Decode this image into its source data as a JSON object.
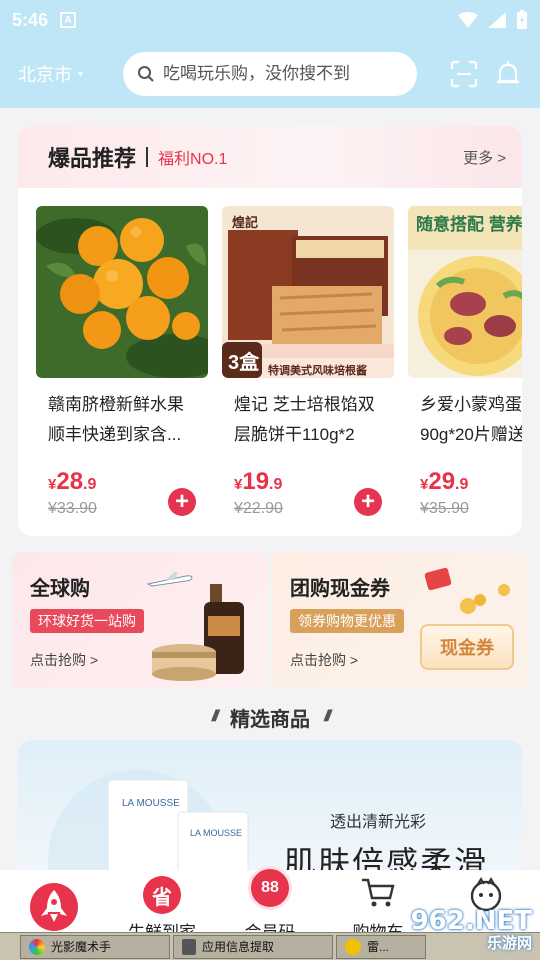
{
  "status": {
    "time": "5:46",
    "app_badge": "A"
  },
  "header": {
    "city": "北京市",
    "search_placeholder": "吃喝玩乐购，没你搜不到"
  },
  "hot": {
    "title": "爆品推荐",
    "subtitle": "福利NO.1",
    "more": "更多 >",
    "products": [
      {
        "name": "赣南脐橙新鲜水果\n顺丰快递到家含...",
        "yen": "¥",
        "price_int": "28",
        "price_dec": ".9",
        "original": "¥33.90"
      },
      {
        "name": "煌记 芝士培根馅双\n层脆饼干110g*2",
        "yen": "¥",
        "price_int": "19",
        "price_dec": ".9",
        "original": "¥22.90",
        "img_brand": "煌記",
        "img_box": "3盒",
        "img_tag": "特调美式风味培根酱"
      },
      {
        "name": "乡爱小蒙鸡蛋\n90g*20片赠送",
        "yen": "¥",
        "price_int": "29",
        "price_dec": ".9",
        "original": "¥35.90",
        "img_tag": "随意搭配 营养"
      }
    ]
  },
  "promos": [
    {
      "title": "全球购",
      "tag": "环球好货一站购",
      "link": "点击抢购 >"
    },
    {
      "title": "团购现金券",
      "tag": "领券购物更优惠",
      "link": "点击抢购 >",
      "coupon": "现金券"
    }
  ],
  "section": {
    "title": "精选商品"
  },
  "banner": {
    "brand": "LA MOUSSE",
    "small": "透出清新光彩",
    "big": "肌肤倍感柔滑"
  },
  "tabs": [
    {
      "label": ""
    },
    {
      "label": "生鲜到家",
      "icon_char": "省"
    },
    {
      "label": "会员码",
      "icon_char": "88"
    },
    {
      "label": "购物车"
    },
    {
      "label": ""
    }
  ],
  "taskbar": [
    "光影魔术手",
    "应用信息提取",
    "雷..."
  ],
  "watermark": {
    "main": "962.NET",
    "sub": "乐游网"
  },
  "colors": {
    "accent": "#e6334a",
    "header_bg": "#bfe6f7"
  }
}
